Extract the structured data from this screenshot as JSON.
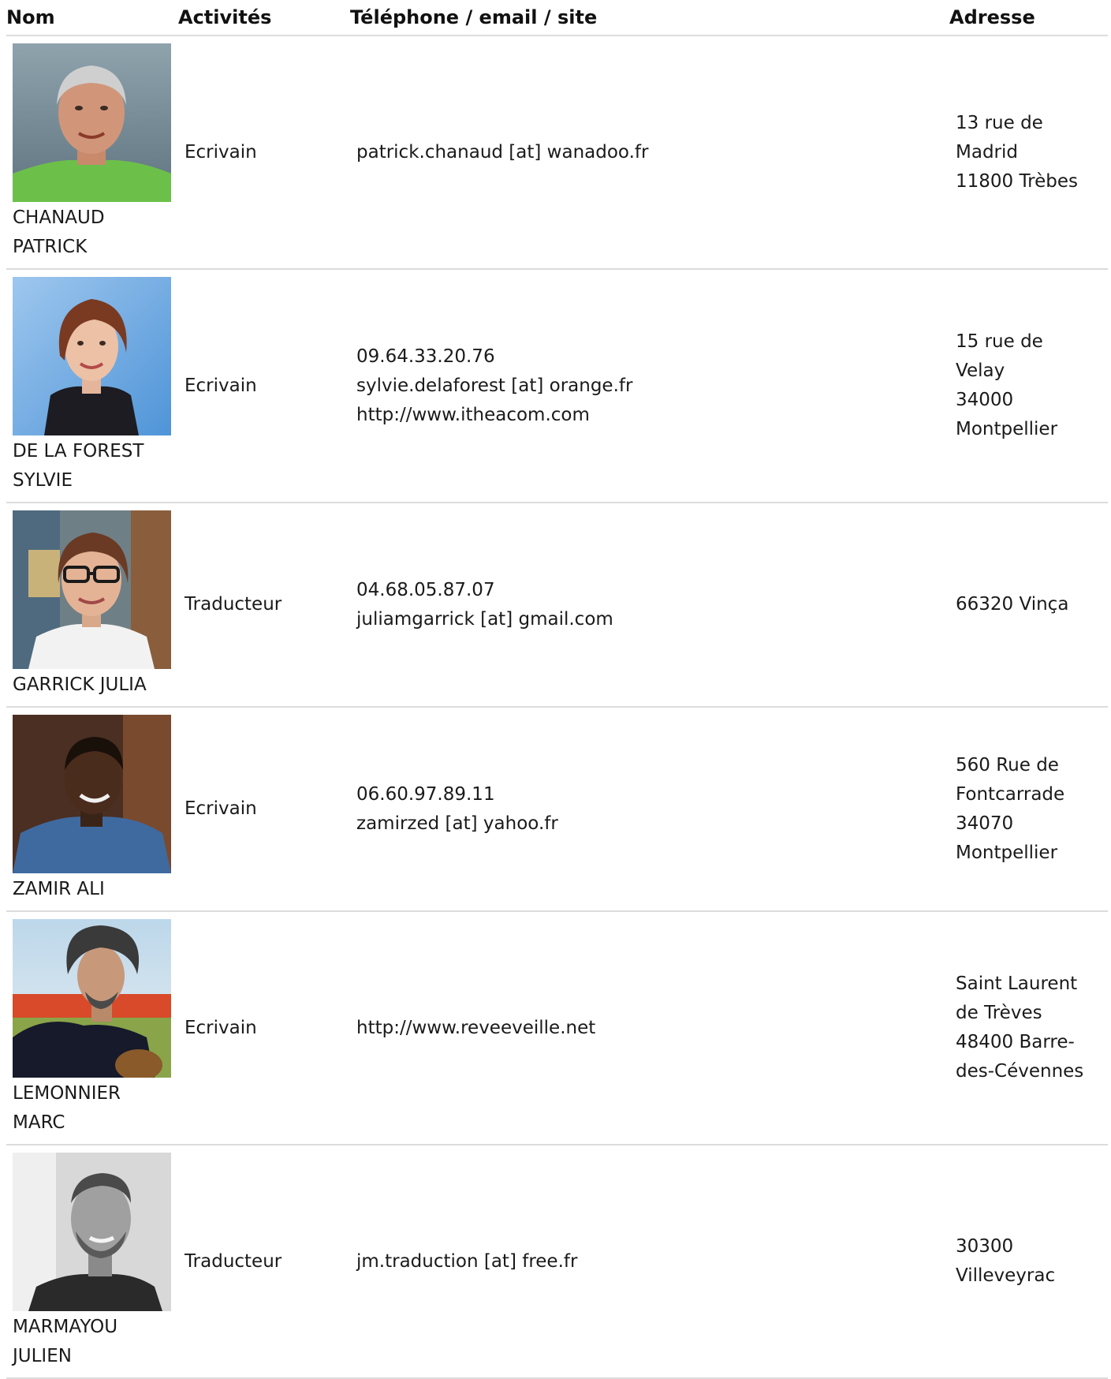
{
  "headers": {
    "nom": "Nom",
    "activites": "Activités",
    "contact": "Téléphone / email / site",
    "adresse": "Adresse"
  },
  "people": [
    {
      "name_lines": [
        "CHANAUD",
        "PATRICK"
      ],
      "activity": "Ecrivain",
      "contact_lines": [
        "patrick.chanaud [at] wanadoo.fr"
      ],
      "address_lines": [
        "13 rue de",
        "Madrid",
        "11800 Trèbes"
      ]
    },
    {
      "name_lines": [
        "DE LA FOREST",
        "SYLVIE"
      ],
      "activity": "Ecrivain",
      "contact_lines": [
        "09.64.33.20.76",
        "sylvie.delaforest [at] orange.fr",
        "http://www.itheacom.com"
      ],
      "address_lines": [
        "15 rue de",
        "Velay",
        "34000",
        "Montpellier"
      ]
    },
    {
      "name_lines": [
        "GARRICK JULIA"
      ],
      "activity": "Traducteur",
      "contact_lines": [
        "04.68.05.87.07",
        "juliamgarrick [at] gmail.com"
      ],
      "address_lines": [
        "66320 Vinça"
      ]
    },
    {
      "name_lines": [
        "ZAMIR ALI"
      ],
      "activity": "Ecrivain",
      "contact_lines": [
        "06.60.97.89.11",
        "zamirzed [at] yahoo.fr"
      ],
      "address_lines": [
        "560 Rue de",
        "Fontcarrade",
        "34070",
        "Montpellier"
      ]
    },
    {
      "name_lines": [
        "LEMONNIER",
        "MARC"
      ],
      "activity": "Ecrivain",
      "contact_lines": [
        "http://www.reveeveille.net"
      ],
      "address_lines": [
        "Saint Laurent",
        "de Trèves",
        "48400 Barre-",
        "des-Cévennes"
      ]
    },
    {
      "name_lines": [
        "MARMAYOU",
        "JULIEN"
      ],
      "activity": "Traducteur",
      "contact_lines": [
        "jm.traduction [at] free.fr"
      ],
      "address_lines": [
        "30300",
        "Villeveyrac"
      ]
    }
  ]
}
